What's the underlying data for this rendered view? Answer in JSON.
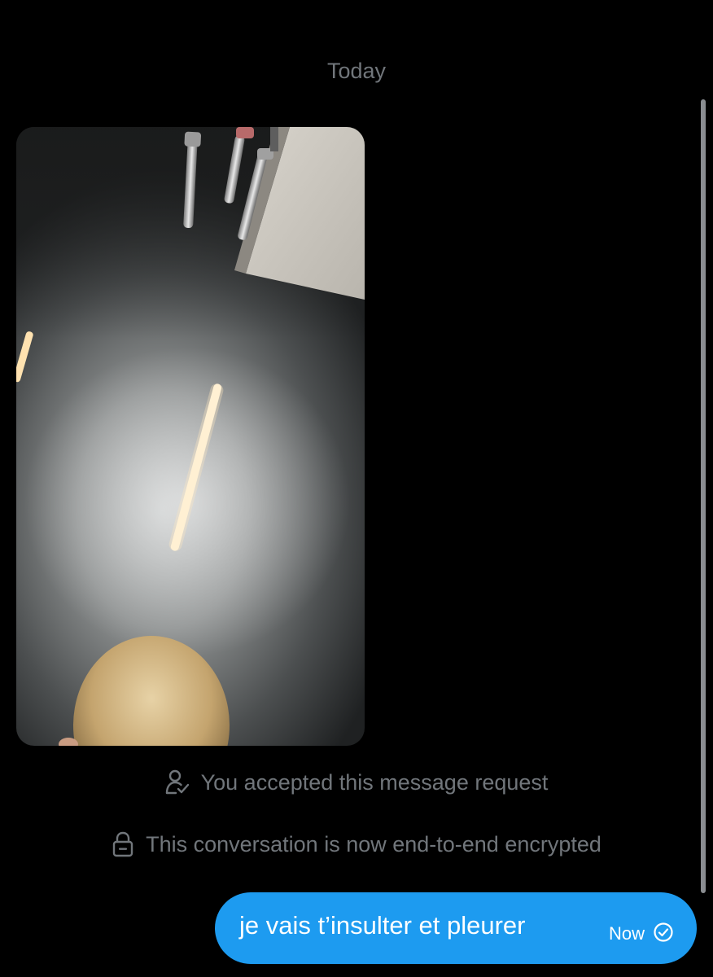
{
  "conversation": {
    "day_separator": "Today",
    "media_message": {
      "kind": "photo",
      "image_icon": "photo-image"
    },
    "system_notes": [
      {
        "icon": "user-check-icon",
        "text": "You accepted this message request"
      },
      {
        "icon": "lock-icon",
        "text": "This conversation is now end-to-end encrypted"
      }
    ],
    "outgoing_message": {
      "text": "je vais t’insulter et pleurer",
      "time": "Now",
      "status_icon": "sent-check-icon"
    }
  },
  "colors": {
    "background": "#000000",
    "secondary_text": "#71767b",
    "bubble_accent": "#1d9bf0"
  }
}
